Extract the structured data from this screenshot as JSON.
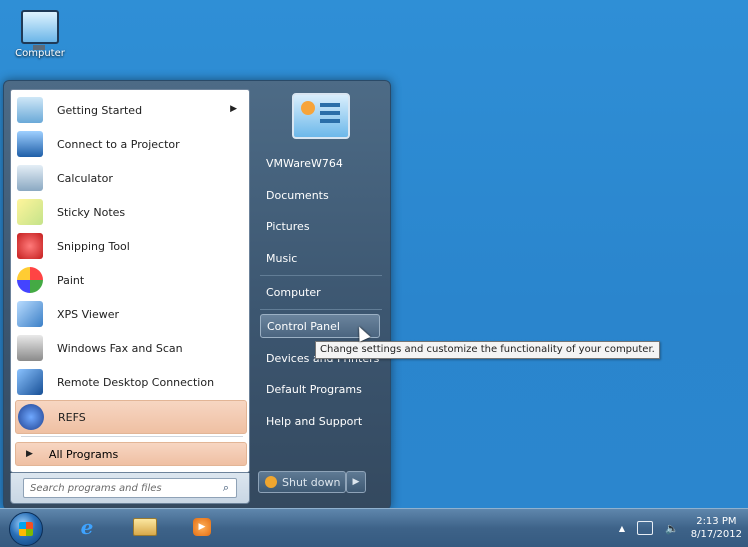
{
  "desktop": {
    "icons": [
      {
        "label": "Computer",
        "icon": "computer-icon"
      }
    ]
  },
  "start_menu": {
    "programs": [
      {
        "label": "Getting Started",
        "icon": "getting-started-icon",
        "has_submenu": true
      },
      {
        "label": "Connect to a Projector",
        "icon": "projector-icon"
      },
      {
        "label": "Calculator",
        "icon": "calculator-icon"
      },
      {
        "label": "Sticky Notes",
        "icon": "sticky-notes-icon"
      },
      {
        "label": "Snipping Tool",
        "icon": "snipping-tool-icon"
      },
      {
        "label": "Paint",
        "icon": "paint-icon"
      },
      {
        "label": "XPS Viewer",
        "icon": "xps-viewer-icon"
      },
      {
        "label": "Windows Fax and Scan",
        "icon": "fax-scan-icon"
      },
      {
        "label": "Remote Desktop Connection",
        "icon": "remote-desktop-icon"
      },
      {
        "label": "REFS",
        "icon": "refs-icon",
        "highlighted": true
      }
    ],
    "all_programs": "All Programs",
    "search_placeholder": "Search programs and files",
    "right_items": [
      {
        "label": "VMWareW764"
      },
      {
        "label": "Documents"
      },
      {
        "label": "Pictures"
      },
      {
        "label": "Music"
      },
      {
        "label": "Computer"
      },
      {
        "label": "Control Panel",
        "active": true
      },
      {
        "label": "Devices and Printers"
      },
      {
        "label": "Default Programs"
      },
      {
        "label": "Help and Support"
      }
    ],
    "shutdown_label": "Shut down",
    "tooltip": "Change settings and customize the functionality of your computer."
  },
  "taskbar": {
    "pinned": [
      "internet-explorer-icon",
      "windows-explorer-icon",
      "media-player-icon"
    ],
    "clock_time": "2:13 PM",
    "clock_date": "8/17/2012"
  },
  "colors": {
    "desktop": "#2a86cc",
    "start_menu_frame": "#3c5670",
    "highlight": "#efc0a3"
  }
}
